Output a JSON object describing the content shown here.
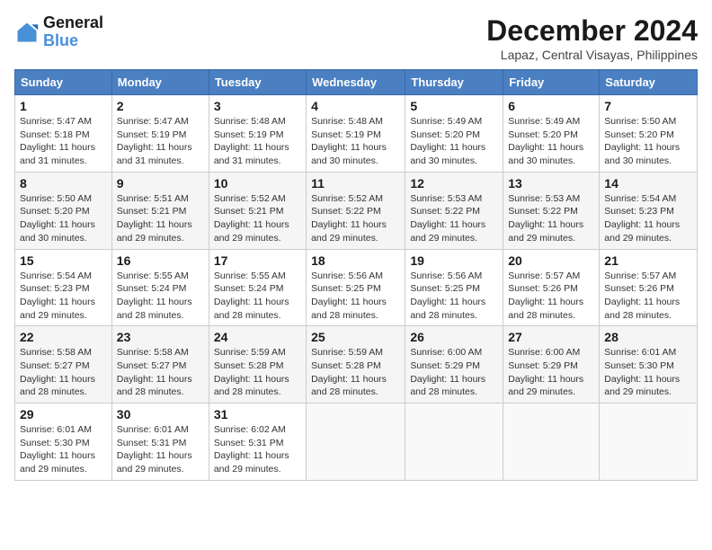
{
  "logo": {
    "line1": "General",
    "line2": "Blue"
  },
  "title": "December 2024",
  "location": "Lapaz, Central Visayas, Philippines",
  "weekdays": [
    "Sunday",
    "Monday",
    "Tuesday",
    "Wednesday",
    "Thursday",
    "Friday",
    "Saturday"
  ],
  "weeks": [
    [
      {
        "day": "1",
        "sunrise": "5:47 AM",
        "sunset": "5:18 PM",
        "daylight": "11 hours and 31 minutes."
      },
      {
        "day": "2",
        "sunrise": "5:47 AM",
        "sunset": "5:19 PM",
        "daylight": "11 hours and 31 minutes."
      },
      {
        "day": "3",
        "sunrise": "5:48 AM",
        "sunset": "5:19 PM",
        "daylight": "11 hours and 31 minutes."
      },
      {
        "day": "4",
        "sunrise": "5:48 AM",
        "sunset": "5:19 PM",
        "daylight": "11 hours and 30 minutes."
      },
      {
        "day": "5",
        "sunrise": "5:49 AM",
        "sunset": "5:20 PM",
        "daylight": "11 hours and 30 minutes."
      },
      {
        "day": "6",
        "sunrise": "5:49 AM",
        "sunset": "5:20 PM",
        "daylight": "11 hours and 30 minutes."
      },
      {
        "day": "7",
        "sunrise": "5:50 AM",
        "sunset": "5:20 PM",
        "daylight": "11 hours and 30 minutes."
      }
    ],
    [
      {
        "day": "8",
        "sunrise": "5:50 AM",
        "sunset": "5:20 PM",
        "daylight": "11 hours and 30 minutes."
      },
      {
        "day": "9",
        "sunrise": "5:51 AM",
        "sunset": "5:21 PM",
        "daylight": "11 hours and 29 minutes."
      },
      {
        "day": "10",
        "sunrise": "5:52 AM",
        "sunset": "5:21 PM",
        "daylight": "11 hours and 29 minutes."
      },
      {
        "day": "11",
        "sunrise": "5:52 AM",
        "sunset": "5:22 PM",
        "daylight": "11 hours and 29 minutes."
      },
      {
        "day": "12",
        "sunrise": "5:53 AM",
        "sunset": "5:22 PM",
        "daylight": "11 hours and 29 minutes."
      },
      {
        "day": "13",
        "sunrise": "5:53 AM",
        "sunset": "5:22 PM",
        "daylight": "11 hours and 29 minutes."
      },
      {
        "day": "14",
        "sunrise": "5:54 AM",
        "sunset": "5:23 PM",
        "daylight": "11 hours and 29 minutes."
      }
    ],
    [
      {
        "day": "15",
        "sunrise": "5:54 AM",
        "sunset": "5:23 PM",
        "daylight": "11 hours and 29 minutes."
      },
      {
        "day": "16",
        "sunrise": "5:55 AM",
        "sunset": "5:24 PM",
        "daylight": "11 hours and 28 minutes."
      },
      {
        "day": "17",
        "sunrise": "5:55 AM",
        "sunset": "5:24 PM",
        "daylight": "11 hours and 28 minutes."
      },
      {
        "day": "18",
        "sunrise": "5:56 AM",
        "sunset": "5:25 PM",
        "daylight": "11 hours and 28 minutes."
      },
      {
        "day": "19",
        "sunrise": "5:56 AM",
        "sunset": "5:25 PM",
        "daylight": "11 hours and 28 minutes."
      },
      {
        "day": "20",
        "sunrise": "5:57 AM",
        "sunset": "5:26 PM",
        "daylight": "11 hours and 28 minutes."
      },
      {
        "day": "21",
        "sunrise": "5:57 AM",
        "sunset": "5:26 PM",
        "daylight": "11 hours and 28 minutes."
      }
    ],
    [
      {
        "day": "22",
        "sunrise": "5:58 AM",
        "sunset": "5:27 PM",
        "daylight": "11 hours and 28 minutes."
      },
      {
        "day": "23",
        "sunrise": "5:58 AM",
        "sunset": "5:27 PM",
        "daylight": "11 hours and 28 minutes."
      },
      {
        "day": "24",
        "sunrise": "5:59 AM",
        "sunset": "5:28 PM",
        "daylight": "11 hours and 28 minutes."
      },
      {
        "day": "25",
        "sunrise": "5:59 AM",
        "sunset": "5:28 PM",
        "daylight": "11 hours and 28 minutes."
      },
      {
        "day": "26",
        "sunrise": "6:00 AM",
        "sunset": "5:29 PM",
        "daylight": "11 hours and 28 minutes."
      },
      {
        "day": "27",
        "sunrise": "6:00 AM",
        "sunset": "5:29 PM",
        "daylight": "11 hours and 29 minutes."
      },
      {
        "day": "28",
        "sunrise": "6:01 AM",
        "sunset": "5:30 PM",
        "daylight": "11 hours and 29 minutes."
      }
    ],
    [
      {
        "day": "29",
        "sunrise": "6:01 AM",
        "sunset": "5:30 PM",
        "daylight": "11 hours and 29 minutes."
      },
      {
        "day": "30",
        "sunrise": "6:01 AM",
        "sunset": "5:31 PM",
        "daylight": "11 hours and 29 minutes."
      },
      {
        "day": "31",
        "sunrise": "6:02 AM",
        "sunset": "5:31 PM",
        "daylight": "11 hours and 29 minutes."
      },
      null,
      null,
      null,
      null
    ]
  ]
}
